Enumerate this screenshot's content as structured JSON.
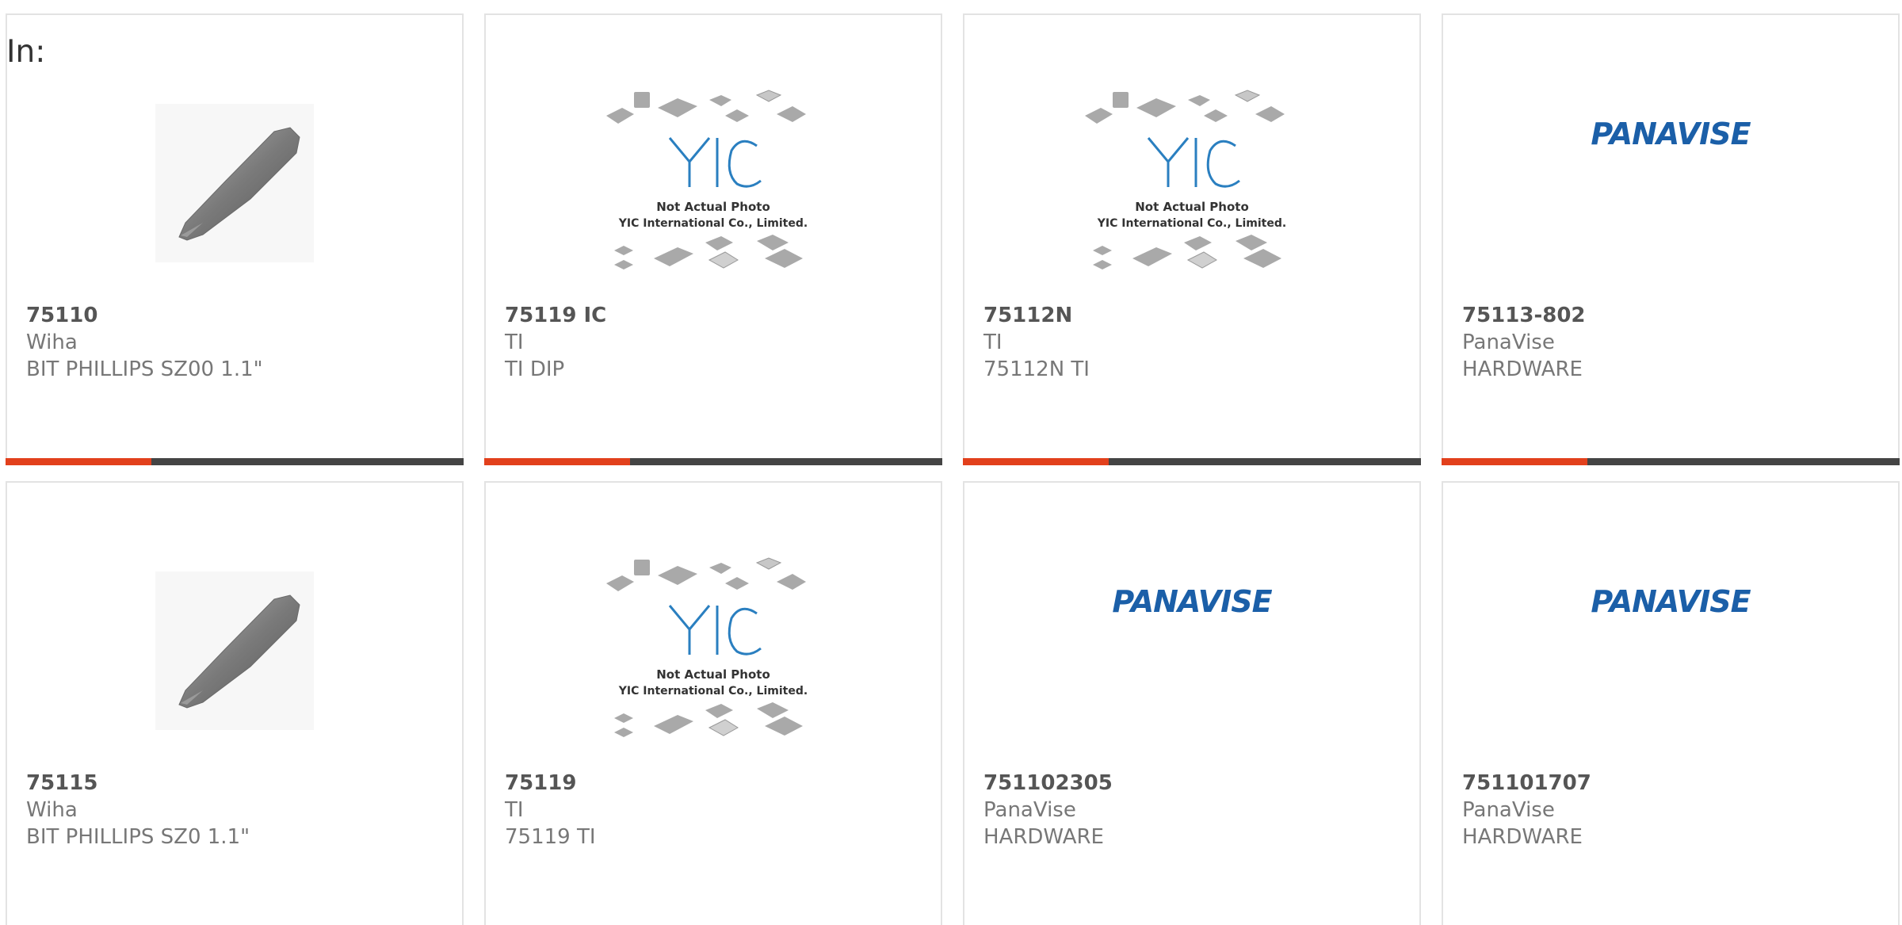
{
  "filter": {
    "label": "In:"
  },
  "products": [
    {
      "part": "75110",
      "manufacturer": "Wiha",
      "description": "BIT PHILLIPS SZ00 1.1\"",
      "image": "screwdriver-bit-image"
    },
    {
      "part": "75119 IC",
      "manufacturer": "TI",
      "description": "TI DIP",
      "image": "yic-placeholder-image",
      "image_caption_1": "Not Actual Photo",
      "image_caption_2": "YIC International Co., Limited."
    },
    {
      "part": "75112N",
      "manufacturer": "TI",
      "description": "75112N TI",
      "image": "yic-placeholder-image",
      "image_caption_1": "Not Actual Photo",
      "image_caption_2": "YIC International Co., Limited."
    },
    {
      "part": "75113-802",
      "manufacturer": "PanaVise",
      "description": "HARDWARE",
      "image": "panavise-logo-image",
      "logo_text": "PANAVISE"
    },
    {
      "part": "75115",
      "manufacturer": "Wiha",
      "description": "BIT PHILLIPS SZ0 1.1\"",
      "image": "screwdriver-bit-image"
    },
    {
      "part": "75119",
      "manufacturer": "TI",
      "description": "75119 TI",
      "image": "yic-placeholder-image",
      "image_caption_1": "Not Actual Photo",
      "image_caption_2": "YIC International Co., Limited."
    },
    {
      "part": "751102305",
      "manufacturer": "PanaVise",
      "description": "HARDWARE",
      "image": "panavise-logo-image",
      "logo_text": "PANAVISE"
    },
    {
      "part": "751101707",
      "manufacturer": "PanaVise",
      "description": "HARDWARE",
      "image": "panavise-logo-image",
      "logo_text": "PANAVISE"
    }
  ],
  "colors": {
    "accent": "#e2401c",
    "bar": "#444444",
    "card_border": "#e3e3e3",
    "yic_blue": "#2a7fc0",
    "panavise_blue": "#1b5fa8"
  }
}
